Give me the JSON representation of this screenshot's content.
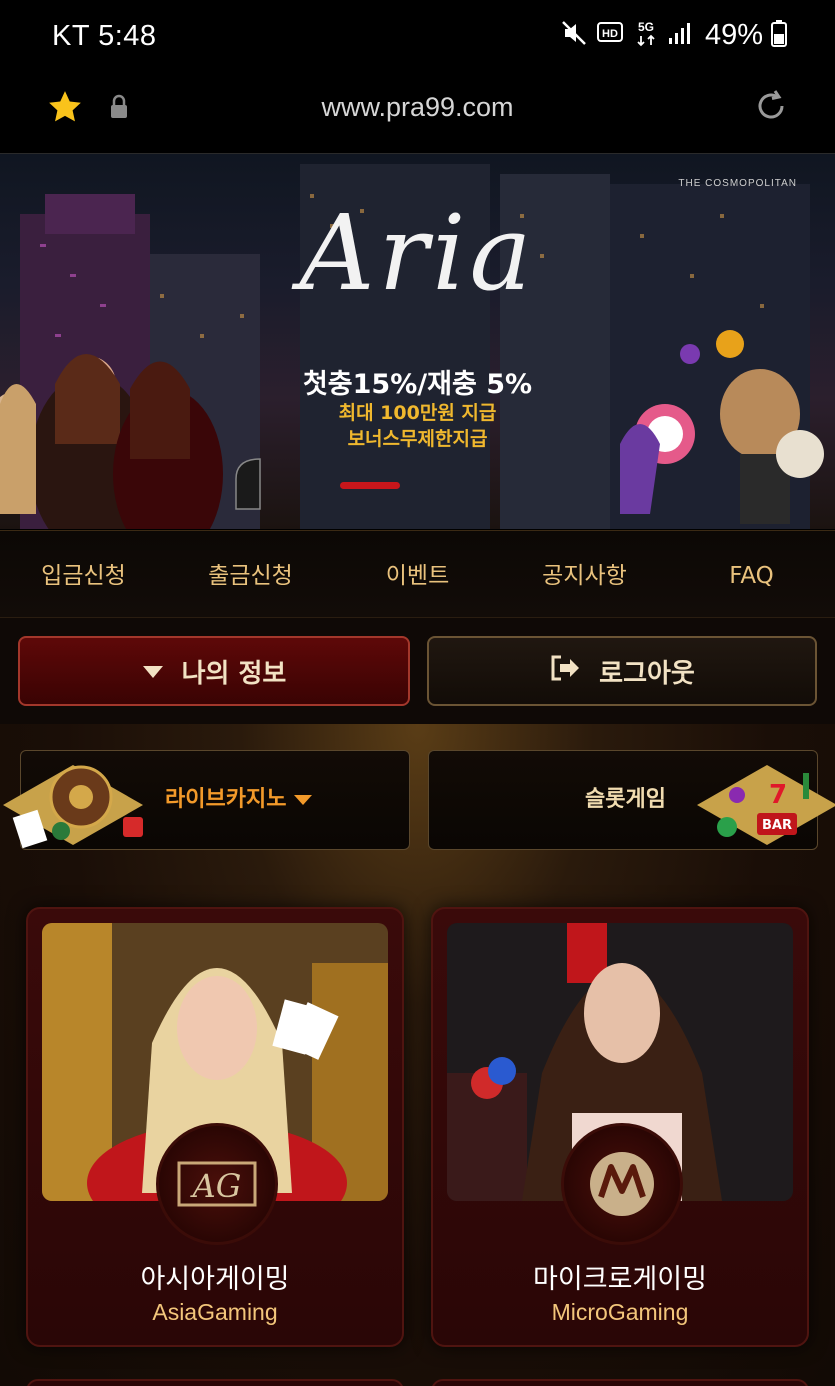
{
  "status_bar": {
    "carrier_time": "KT 5:48",
    "battery": "49%",
    "icons": [
      "mute-icon",
      "hd-icon",
      "5g-icon",
      "signal-icon",
      "battery-icon"
    ]
  },
  "browser": {
    "url": "www.pra99.com",
    "icons": [
      "star-icon",
      "lock-icon",
      "reload-icon"
    ]
  },
  "banner": {
    "logo_text": "Aria",
    "promo_line1": "첫충15%/재충 5%",
    "promo_line2": "최대 100만원 지급",
    "promo_line3": "보너스무제한지급",
    "building_sign": "THE COSMOPOLITAN"
  },
  "nav": {
    "items": [
      {
        "label": "입금신청"
      },
      {
        "label": "출금신청"
      },
      {
        "label": "이벤트"
      },
      {
        "label": "공지사항"
      },
      {
        "label": "FAQ"
      }
    ]
  },
  "actions": {
    "my_info": "나의 정보",
    "logout": "로그아웃"
  },
  "categories": {
    "live_casino": "라이브카지노",
    "slot_games": "슬롯게임"
  },
  "providers": [
    {
      "name_ko": "아시아게이밍",
      "name_en": "AsiaGaming",
      "badge": "AG"
    },
    {
      "name_ko": "마이크로게이밍",
      "name_en": "MicroGaming",
      "badge": "M"
    }
  ],
  "colors": {
    "accent_gold": "#e9c27d",
    "accent_orange": "#f39a2a",
    "button_red": "#5e0808",
    "indicator_red": "#c8161b"
  }
}
